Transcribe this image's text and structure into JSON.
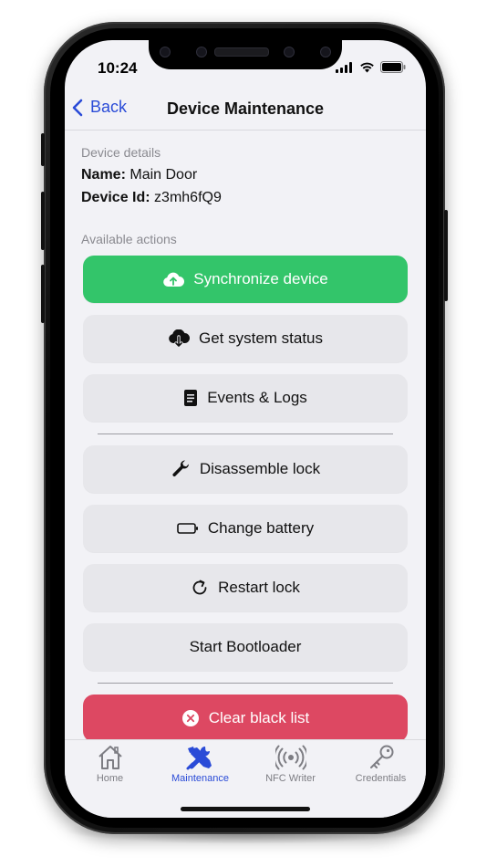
{
  "status_bar": {
    "time": "10:24",
    "icons": [
      "signal-icon",
      "wifi-icon",
      "battery-icon"
    ]
  },
  "nav": {
    "back_label": "Back",
    "title": "Device Maintenance"
  },
  "details": {
    "section_label": "Device details",
    "name_label": "Name:",
    "name_value": "Main Door",
    "id_label": "Device Id:",
    "id_value": "z3mh6fQ9"
  },
  "actions": {
    "section_label": "Available actions",
    "sync": "Synchronize device",
    "status": "Get system status",
    "events": "Events & Logs",
    "disassemble": "Disassemble lock",
    "battery": "Change battery",
    "restart": "Restart lock",
    "bootloader": "Start Bootloader",
    "clear_blacklist": "Clear black list"
  },
  "colors": {
    "accent": "#2a4bd7",
    "green": "#33c56a",
    "red": "#dd4862"
  },
  "tabbar": {
    "items": [
      {
        "label": "Home",
        "icon": "house-icon"
      },
      {
        "label": "Maintenance",
        "icon": "tools-icon",
        "active": true
      },
      {
        "label": "NFC Writer",
        "icon": "nfc-icon"
      },
      {
        "label": "Credentials",
        "icon": "key-icon"
      }
    ]
  }
}
